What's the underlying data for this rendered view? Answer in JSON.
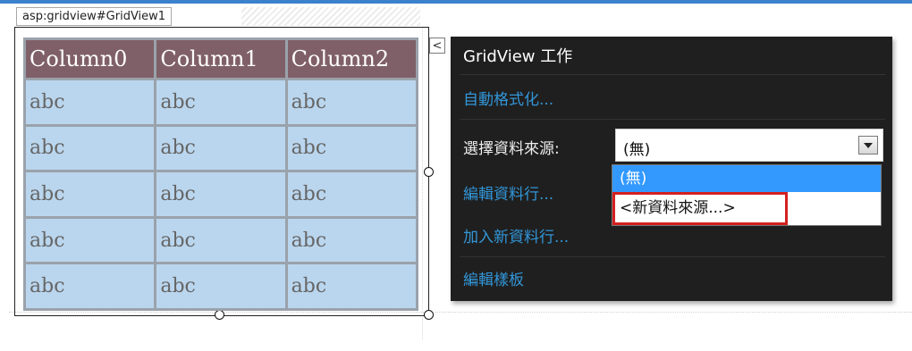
{
  "control_tag": "asp:gridview#GridView1",
  "grid": {
    "headers": [
      "Column0",
      "Column1",
      "Column2"
    ],
    "rows": [
      [
        "abc",
        "abc",
        "abc"
      ],
      [
        "abc",
        "abc",
        "abc"
      ],
      [
        "abc",
        "abc",
        "abc"
      ],
      [
        "abc",
        "abc",
        "abc"
      ],
      [
        "abc",
        "abc",
        "abc"
      ]
    ],
    "colors": {
      "header_bg": "#806068",
      "cell_bg": "#bad6ee",
      "grid_lines": "#9aa2ab"
    }
  },
  "smart_tag": {
    "collapse_glyph": "<",
    "title": "GridView 工作",
    "auto_format": "自動格式化...",
    "choose_ds_label": "選擇資料來源:",
    "choose_ds_value": "(無)",
    "options": [
      "(無)",
      "<新資料來源...>"
    ],
    "edit_columns": "編輯資料行...",
    "add_column": "加入新資料行...",
    "edit_templates": "編輯樣板",
    "colors": {
      "panel_bg": "#1f1f1f",
      "link": "#3296d8",
      "selection": "#3399ff",
      "highlight": "#d42020"
    }
  }
}
